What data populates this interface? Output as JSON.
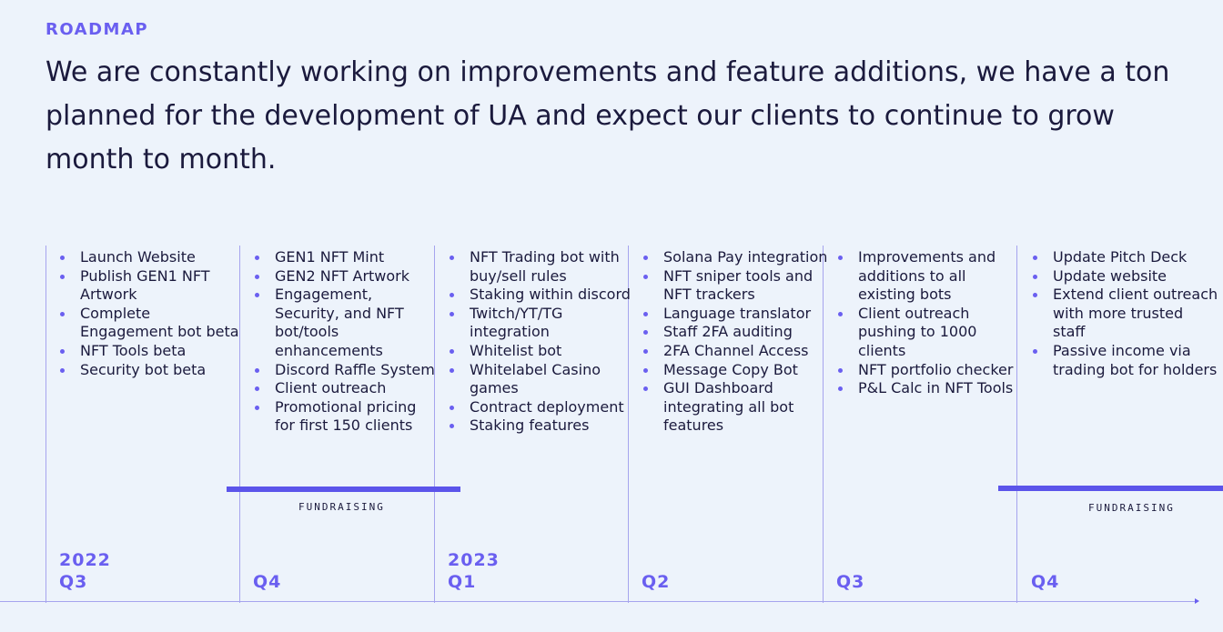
{
  "header": {
    "eyebrow": "ROADMAP",
    "headline": "We are constantly working on improvements and feature additions, we have a ton planned for the development of UA and expect our clients to continue to grow month to month."
  },
  "timeline": {
    "columns": [
      {
        "year": "2022",
        "quarter": "Q3",
        "items": [
          "Launch Website",
          "Publish GEN1 NFT Artwork",
          "Complete Engagement bot beta",
          "NFT Tools beta",
          "Security bot beta"
        ]
      },
      {
        "year": "",
        "quarter": "Q4",
        "items": [
          "GEN1 NFT Mint",
          "GEN2 NFT Artwork",
          "Engagement, Security, and NFT bot/tools enhancements",
          "Discord Raffle System",
          "Client outreach",
          "Promotional pricing for first 150 clients"
        ]
      },
      {
        "year": "2023",
        "quarter": "Q1",
        "items": [
          "NFT Trading bot with buy/sell rules",
          "Staking within discord",
          "Twitch/YT/TG integration",
          "Whitelist bot",
          "Whitelabel Casino games",
          "Contract deployment",
          "Staking features"
        ]
      },
      {
        "year": "",
        "quarter": "Q2",
        "items": [
          "Solana Pay integration",
          "NFT sniper tools and NFT trackers",
          "Language translator",
          "Staff 2FA auditing",
          "2FA Channel Access",
          "Message Copy Bot",
          "GUI Dashboard integrating all bot features"
        ]
      },
      {
        "year": "",
        "quarter": "Q3",
        "items": [
          "Improvements and additions to all existing bots",
          "Client outreach pushing to 1000 clients",
          "NFT portfolio checker",
          "P&L Calc in NFT Tools"
        ]
      },
      {
        "year": "",
        "quarter": "Q4",
        "items": [
          "Update Pitch Deck",
          "Update website",
          "Extend client outreach with more trusted staff",
          "Passive income via trading bot for holders"
        ]
      }
    ],
    "fundraising": [
      {
        "label": "FUNDRAISING"
      },
      {
        "label": "FUNDRAISING"
      }
    ],
    "accent_color": "#6a5ff0"
  }
}
